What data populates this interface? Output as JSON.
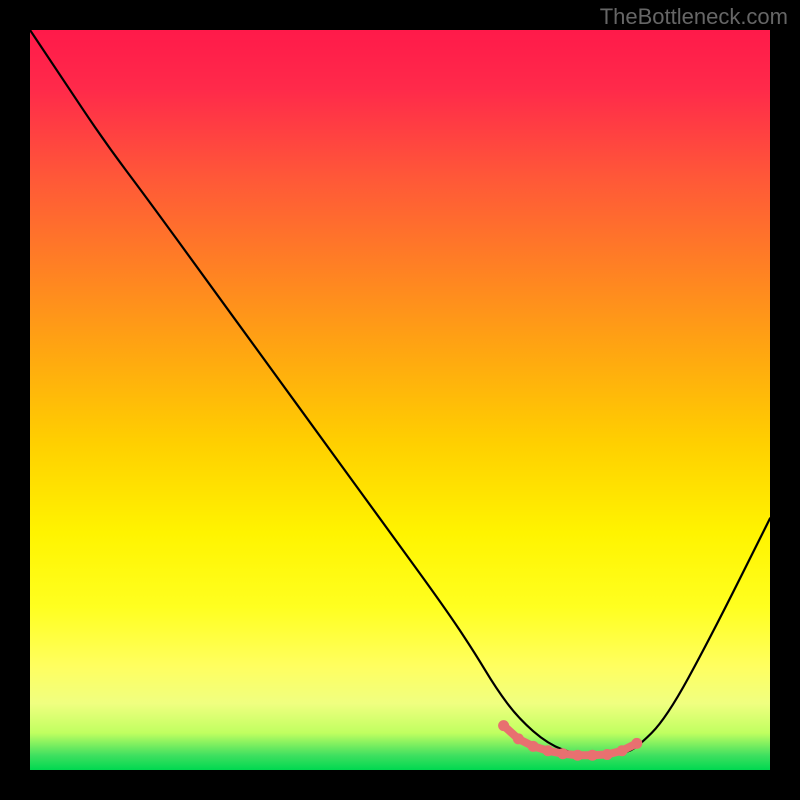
{
  "watermark": "TheBottleneck.com",
  "chart_data": {
    "type": "line",
    "title": "",
    "xlabel": "",
    "ylabel": "",
    "xlim": [
      0,
      100
    ],
    "ylim": [
      0,
      100
    ],
    "grid": false,
    "series": [
      {
        "name": "bottleneck-curve",
        "x": [
          0,
          4,
          10,
          16,
          24,
          32,
          40,
          48,
          56,
          60,
          63,
          66,
          70,
          74,
          78,
          80,
          82,
          86,
          92,
          100
        ],
        "y": [
          100,
          94,
          85,
          77,
          66,
          55,
          44,
          33,
          22,
          16,
          11,
          7,
          3.5,
          2,
          2,
          2.2,
          3,
          7,
          18,
          34
        ]
      }
    ],
    "markers": {
      "name": "optimal-range",
      "color": "#e87070",
      "x": [
        64,
        66,
        68,
        70,
        72,
        74,
        76,
        78,
        80,
        82
      ],
      "y": [
        6,
        4.2,
        3.2,
        2.6,
        2.2,
        2,
        2,
        2.1,
        2.6,
        3.6
      ]
    }
  },
  "colors": {
    "curve": "#000000",
    "marker": "#e87070",
    "background_top": "#ff1a4a",
    "background_bottom": "#00d850",
    "frame": "#000000"
  }
}
